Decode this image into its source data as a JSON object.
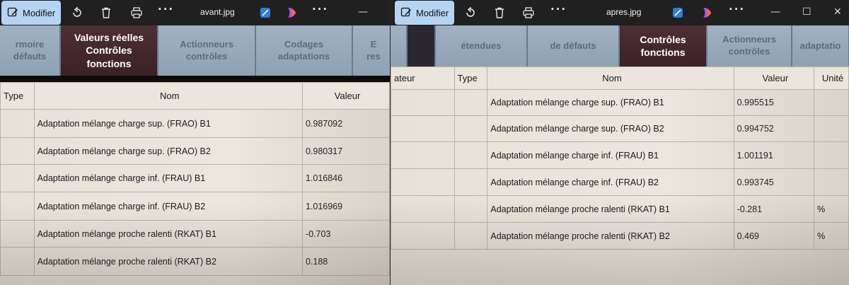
{
  "left": {
    "toolbar": {
      "modifier_label": "Modifier",
      "file_name": "avant.jpg",
      "more": "···",
      "minimize": "—"
    },
    "tabs": [
      {
        "label": "rmoire\ndéfauts"
      },
      {
        "label": "Valeurs réelles\nContrôles\nfonctions",
        "active": true
      },
      {
        "label": "Actionneurs\ncontrôles"
      },
      {
        "label": "Codages\nadaptations"
      },
      {
        "label": "E\nres"
      }
    ],
    "table": {
      "headers": [
        "Type",
        "Nom",
        "Valeur"
      ],
      "rows": [
        {
          "type": "",
          "nom": "Adaptation mélange charge sup. (FRAO) B1",
          "valeur": "0.987092"
        },
        {
          "type": "",
          "nom": "Adaptation mélange charge sup. (FRAO) B2",
          "valeur": "0.980317"
        },
        {
          "type": "",
          "nom": "Adaptation mélange charge inf. (FRAU) B1",
          "valeur": "1.016846"
        },
        {
          "type": "",
          "nom": "Adaptation mélange charge inf. (FRAU) B2",
          "valeur": "1.016969"
        },
        {
          "type": "",
          "nom": "Adaptation mélange proche ralenti (RKAT) B1",
          "valeur": "-0.703"
        },
        {
          "type": "",
          "nom": "Adaptation mélange proche ralenti (RKAT) B2",
          "valeur": "0.188"
        }
      ]
    }
  },
  "right": {
    "toolbar": {
      "modifier_label": "Modifier",
      "file_name": "apres.jpg",
      "more": "···",
      "minimize": "—",
      "maximize": "☐",
      "close": "✕"
    },
    "tabs": [
      {
        "label": ""
      },
      {
        "label": ""
      },
      {
        "label": "étendues"
      },
      {
        "label": "de défauts"
      },
      {
        "label": "Contrôles\nfonctions",
        "active": true
      },
      {
        "label": "Actionneurs\ncontrôles"
      },
      {
        "label": "adaptatio"
      }
    ],
    "table": {
      "headers": [
        "ateur",
        "Type",
        "Nom",
        "Valeur",
        "Unité"
      ],
      "rows": [
        {
          "ateur": "",
          "type": "",
          "nom": "Adaptation mélange charge sup. (FRAO) B1",
          "valeur": "0.995515",
          "unite": ""
        },
        {
          "ateur": "",
          "type": "",
          "nom": "Adaptation mélange charge sup. (FRAO) B2",
          "valeur": "0.994752",
          "unite": ""
        },
        {
          "ateur": "",
          "type": "",
          "nom": "Adaptation mélange charge inf. (FRAU) B1",
          "valeur": "1.001191",
          "unite": ""
        },
        {
          "ateur": "",
          "type": "",
          "nom": "Adaptation mélange charge inf. (FRAU) B2",
          "valeur": "0.993745",
          "unite": ""
        },
        {
          "ateur": "",
          "type": "",
          "nom": "Adaptation mélange proche ralenti (RKAT) B1",
          "valeur": "-0.281",
          "unite": "%"
        },
        {
          "ateur": "",
          "type": "",
          "nom": "Adaptation mélange proche ralenti (RKAT) B2",
          "valeur": "0.469",
          "unite": "%"
        }
      ]
    }
  },
  "icons": {
    "modifier": "edit-image-icon",
    "rotate": "rotate-icon",
    "delete": "trash-icon",
    "print": "printer-icon",
    "edit_app": "image-editor-icon",
    "copilot": "copilot-icon"
  },
  "colors": {
    "toolbar_bg": "#202020",
    "modifier_bg": "#b5d4f1",
    "tab_inactive": "#9fb1c2",
    "tab_active": "#4c2f34",
    "table_bg": "#e7e1d6"
  }
}
